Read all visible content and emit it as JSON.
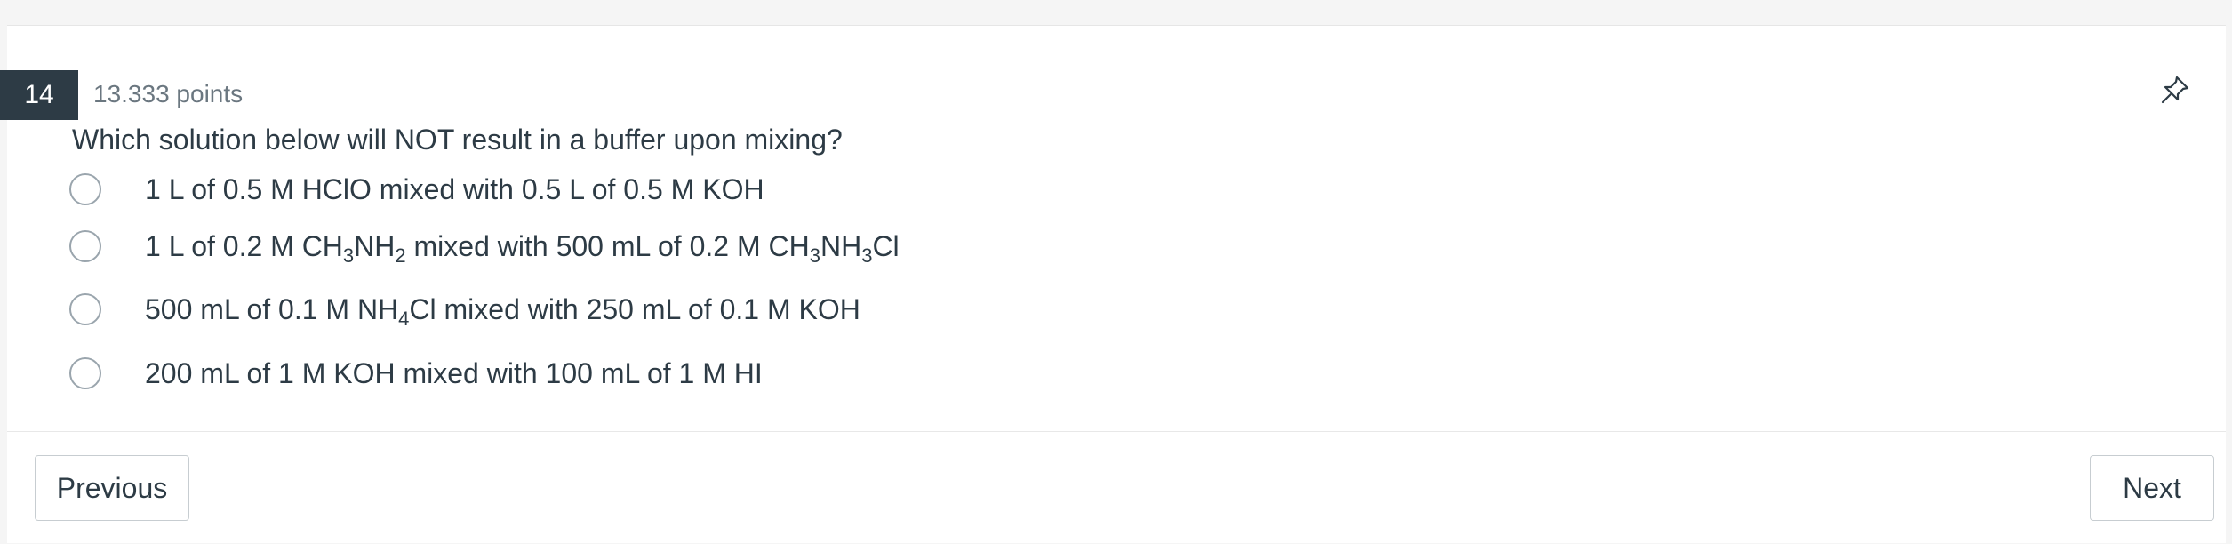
{
  "question": {
    "number": "14",
    "points": "13.333 points",
    "prompt": "Which solution below will NOT result in a buffer upon mixing?",
    "pin_icon": "pin-icon",
    "options": [
      [
        {
          "t": "1 L of 0.5 M HClO mixed with 0.5 L of 0.5 M KOH"
        }
      ],
      [
        {
          "t": "1 L of 0.2 M CH"
        },
        {
          "s": "3"
        },
        {
          "t": "NH"
        },
        {
          "s": "2"
        },
        {
          "t": " mixed with 500 mL of 0.2 M CH"
        },
        {
          "s": "3"
        },
        {
          "t": "NH"
        },
        {
          "s": "3"
        },
        {
          "t": "Cl"
        }
      ],
      [
        {
          "t": "500 mL of 0.1 M NH"
        },
        {
          "s": "4"
        },
        {
          "t": "Cl mixed with 250 mL of 0.1 M KOH"
        }
      ],
      [
        {
          "t": "200 mL of 1 M KOH mixed with 100 mL of 1 M HI"
        }
      ]
    ]
  },
  "nav": {
    "previous_label": "Previous",
    "next_label": "Next"
  }
}
